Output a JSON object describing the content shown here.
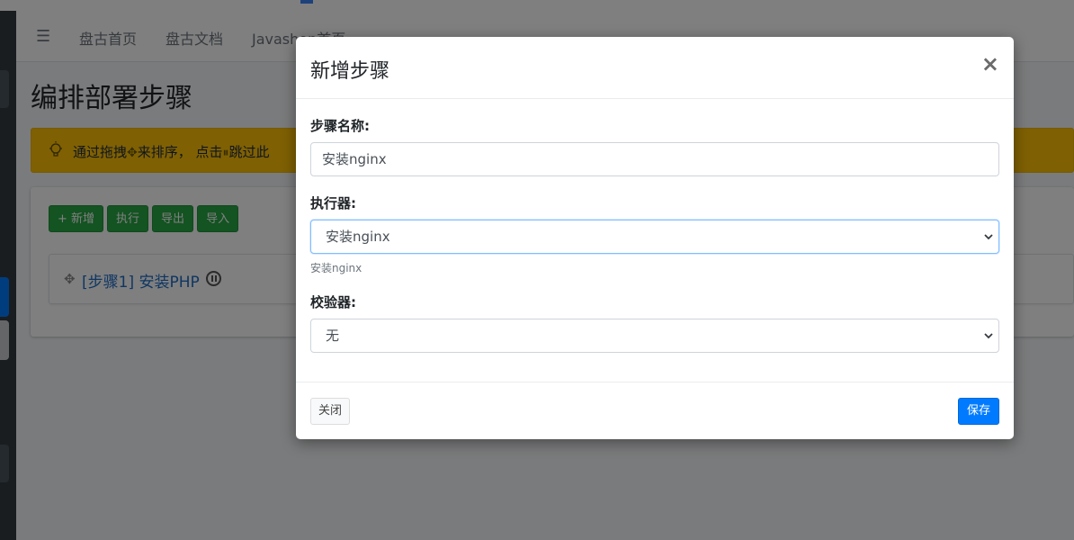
{
  "nav": {
    "links": [
      "盘古首页",
      "盘古文档",
      "Javashop首页"
    ]
  },
  "page": {
    "title": "编排部署步骤",
    "alert": {
      "text1": "通过拖拽",
      "text2": "来排序， 点击",
      "text3": "跳过此"
    },
    "toolbar": {
      "add_label": "+ 新增",
      "exec_label": "执行",
      "export_label": "导出",
      "import_label": "导入"
    },
    "step": {
      "label": "[步骤1]  安装PHP"
    }
  },
  "modal": {
    "title": "新增步骤",
    "close_symbol": "×",
    "name_label": "步骤名称:",
    "name_value": "安装nginx",
    "executor_label": "执行器:",
    "executor_value": "安装nginx",
    "executor_help": "安装nginx",
    "validator_label": "校验器:",
    "validator_value": "无",
    "close_button": "关闭",
    "save_button": "保存"
  },
  "colors": {
    "primary": "#007bff",
    "success": "#28a745",
    "warning": "#ffc107",
    "sidebar": "#343a40"
  }
}
